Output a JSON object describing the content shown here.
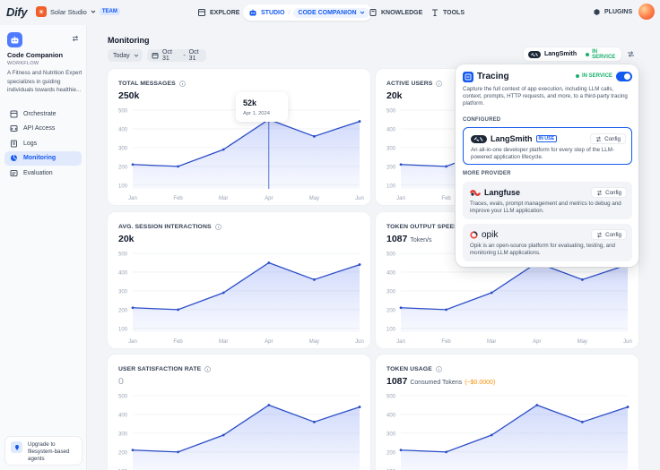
{
  "brand": {
    "logo_text": "Dify"
  },
  "workspace": {
    "initial": "☀",
    "name": "Solar Studio",
    "badge": "TEAM"
  },
  "topnav": {
    "explore": "EXPLORE",
    "studio": "STUDIO",
    "current_app": "CODE COMPANION",
    "knowledge": "KNOWLEDGE",
    "tools": "TOOLS",
    "plugins": "PLUGINS"
  },
  "sidebar": {
    "app_name": "Code Companion",
    "app_type": "WORKFLOW",
    "app_description": "A Fitness and Nutrition Expert specializes in guiding individuals towards healthie...",
    "items": [
      {
        "label": "Orchestrate",
        "icon": "orchestrate-icon"
      },
      {
        "label": "API Access",
        "icon": "api-icon"
      },
      {
        "label": "Logs",
        "icon": "logs-icon"
      },
      {
        "label": "Monitoring",
        "icon": "monitoring-icon",
        "active": true
      },
      {
        "label": "Evaluation",
        "icon": "evaluation-icon"
      }
    ],
    "upgrade_text": "Upgrade to filesystem-based agents"
  },
  "monitoring": {
    "title": "Monitoring",
    "period": "Today",
    "date_from": "Oct 31",
    "date_sep": "-",
    "date_to": "Oct 31"
  },
  "tracing_bar": {
    "provider": "LangSmith",
    "status": "IN SERVICE"
  },
  "tooltip": {
    "value": "52k",
    "date": "Apr 1, 2024"
  },
  "cards": [
    {
      "title": "TOTAL MESSAGES",
      "value": "250k"
    },
    {
      "title": "ACTIVE USERS",
      "value": "20k"
    },
    {
      "title": "AVG. SESSION INTERACTIONS",
      "value": "20k"
    },
    {
      "title": "TOKEN OUTPUT SPEED",
      "value": "1087",
      "unit": "Token/s"
    },
    {
      "title": "USER SATISFACTION RATE",
      "value": "0"
    },
    {
      "title": "TOKEN USAGE",
      "value": "1087",
      "unit": "Consumed Tokens",
      "cost": "(~$0.0000)"
    }
  ],
  "chart_data": [
    {
      "type": "area",
      "title": "TOTAL MESSAGES",
      "categories": [
        "Jan",
        "Feb",
        "Mar",
        "Apr",
        "May",
        "Jun"
      ],
      "values": [
        210,
        200,
        290,
        450,
        360,
        440
      ],
      "yticks": [
        100,
        200,
        300,
        400,
        500
      ],
      "ylim": [
        80,
        500
      ],
      "grid": true
    },
    {
      "type": "area",
      "title": "ACTIVE USERS",
      "categories": [
        "Jan",
        "Feb",
        "Mar",
        "Apr",
        "May",
        "Jun"
      ],
      "values": [
        210,
        200,
        290,
        450,
        360,
        440
      ],
      "yticks": [
        100,
        200,
        300,
        400,
        500
      ],
      "ylim": [
        80,
        500
      ],
      "grid": true
    },
    {
      "type": "area",
      "title": "AVG. SESSION INTERACTIONS",
      "categories": [
        "Jan",
        "Feb",
        "Mar",
        "Apr",
        "May",
        "Jun"
      ],
      "values": [
        210,
        200,
        290,
        450,
        360,
        440
      ],
      "yticks": [
        100,
        200,
        300,
        400,
        500
      ],
      "ylim": [
        80,
        500
      ],
      "grid": true
    },
    {
      "type": "area",
      "title": "TOKEN OUTPUT SPEED",
      "categories": [
        "Jan",
        "Feb",
        "Mar",
        "Apr",
        "May",
        "Jun"
      ],
      "values": [
        210,
        200,
        290,
        450,
        360,
        440
      ],
      "yticks": [
        100,
        200,
        300,
        400,
        500
      ],
      "ylim": [
        80,
        500
      ],
      "grid": true
    },
    {
      "type": "area",
      "title": "USER SATISFACTION RATE",
      "categories": [
        "Jan",
        "Feb",
        "Mar",
        "Apr",
        "May",
        "Jun"
      ],
      "values": [
        210,
        200,
        290,
        450,
        360,
        440
      ],
      "yticks": [
        100,
        200,
        300,
        400,
        500
      ],
      "ylim": [
        80,
        500
      ],
      "grid": true
    },
    {
      "type": "area",
      "title": "TOKEN USAGE",
      "categories": [
        "Jan",
        "Feb",
        "Mar",
        "Apr",
        "May",
        "Jun"
      ],
      "values": [
        210,
        200,
        290,
        450,
        360,
        440
      ],
      "yticks": [
        100,
        200,
        300,
        400,
        500
      ],
      "ylim": [
        80,
        500
      ],
      "grid": true
    }
  ],
  "tracing_panel": {
    "title": "Tracing",
    "status": "IN SERVICE",
    "description": "Capture the full context of app execution, including LLM calls, context, prompts, HTTP requests, and more, to a third-party tracing platform.",
    "configured_label": "CONFIGURED",
    "more_label": "MORE PROVIDER",
    "providers": [
      {
        "name": "LangSmith",
        "badge": "IN USE",
        "config": "Config",
        "description": "An all-in-one developer platform for every step of the LLM-powered application lifecycle."
      },
      {
        "name": "Langfuse",
        "config": "Config",
        "description": "Traces, evals, prompt management and metrics to debug and improve your LLM application."
      },
      {
        "name": "opik",
        "config": "Config",
        "description": "Opik is an open-source platform for evaluating, testing, and monitoring LLM applications."
      }
    ]
  },
  "colors": {
    "accent": "#155aef",
    "line": "#2d4ec8",
    "success": "#17b26a",
    "cost": "#f79009"
  }
}
